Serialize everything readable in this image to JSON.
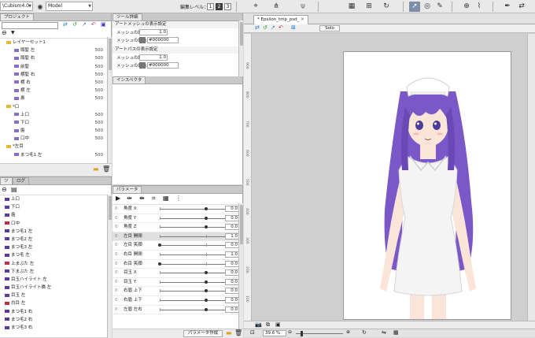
{
  "topbar": {
    "app_combo": "\\Cubism4.0",
    "mode_combo": "Model",
    "edit_level_label": "編集レベル：",
    "levels": [
      "1",
      "2",
      "3"
    ],
    "active_level": "3",
    "tool_icons": [
      "shape-icon",
      "node-icon",
      "move-icon",
      "bone-icon",
      "warp-icon",
      "rotate-icon",
      "deform-icon",
      "select-arrow-icon",
      "lasso-icon",
      "free-icon",
      "pen-icon",
      "brush-icon",
      "pin-icon",
      "mirror-icon"
    ]
  },
  "project": {
    "tab": "プロジェクト",
    "items": [
      {
        "label": "レイヤーセット1",
        "num": ""
      },
      {
        "label": "頭髪 左",
        "num": "500"
      },
      {
        "label": "頭髪 右",
        "num": "500"
      },
      {
        "label": "前髪",
        "num": "500"
      },
      {
        "label": "横髪 右",
        "num": "500"
      },
      {
        "label": "横 右",
        "num": "500"
      },
      {
        "label": "横 左",
        "num": "500"
      },
      {
        "label": "鼻",
        "num": "500"
      },
      {
        "label": "*口",
        "num": ""
      },
      {
        "label": "上口",
        "num": "500"
      },
      {
        "label": "下口",
        "num": "500"
      },
      {
        "label": "歯",
        "num": "500"
      },
      {
        "label": "口中",
        "num": "500"
      },
      {
        "label": "*左目",
        "num": ""
      },
      {
        "label": "まつ毛1 左",
        "num": "500"
      }
    ]
  },
  "tool_detail": {
    "tab": "ツール詳細",
    "section1": "アートメッシュの表示設定",
    "mesh_width_label": "メッシュの線幅",
    "mesh_width_value": "1.0",
    "mesh_color_label": "メッシュの線色",
    "mesh_color_value": "#000000",
    "section2": "アートパスの表示設定",
    "path_width_label": "メッシュの線幅",
    "path_width_value": "1.0",
    "path_color_label": "メッシュの線色",
    "path_color_value": "#000000"
  },
  "inspector": {
    "tab": "インスペクタ"
  },
  "parts": {
    "tabs": [
      "ツ",
      "ログ"
    ],
    "items": [
      "上口",
      "下口",
      "歯",
      "口中",
      "まつ毛1 左",
      "まつ毛2 左",
      "まつ毛3 左",
      "まつ毛 左",
      "上まぶた 左",
      "下まぶた 左",
      "目玉ハイライト 左",
      "目玉ハイライト橋 左",
      "目玉 左",
      "白目 左",
      "まつ毛1 右",
      "まつ毛2 右",
      "まつ毛3 右"
    ]
  },
  "parameters": {
    "tab": "パラメータ",
    "rows": [
      {
        "label": "角度 X",
        "value": "0.0",
        "pos": 0.5,
        "selected": false
      },
      {
        "label": "角度 Y",
        "value": "0.0",
        "pos": 0.5,
        "selected": false
      },
      {
        "label": "角度 Z",
        "value": "0.0",
        "pos": 0.5,
        "selected": false
      },
      {
        "label": "左目 開閉",
        "value": "1.0",
        "pos": 1.0,
        "selected": true
      },
      {
        "label": "左目 笑顔",
        "value": "0.0",
        "pos": 0.0,
        "selected": false
      },
      {
        "label": "右目 開閉",
        "value": "1.0",
        "pos": 1.0,
        "selected": false
      },
      {
        "label": "右目 笑顔",
        "value": "0.0",
        "pos": 0.0,
        "selected": false
      },
      {
        "label": "目玉 X",
        "value": "0.0",
        "pos": 0.5,
        "selected": false
      },
      {
        "label": "目玉 Y",
        "value": "0.0",
        "pos": 0.5,
        "selected": false
      },
      {
        "label": "右眉 上下",
        "value": "0.0",
        "pos": 0.5,
        "selected": false
      },
      {
        "label": "右眉 上下",
        "value": "0.0",
        "pos": 0.5,
        "selected": false
      },
      {
        "label": "左眉 左右",
        "value": "0.0",
        "pos": 0.5,
        "selected": false
      }
    ],
    "create_button": "パラメータ作成"
  },
  "canvas": {
    "tab": "* Epsilon_tmp_psd_",
    "solo": "Solo",
    "zoom": "39.6 %",
    "ruler_labels": [
      "900",
      "800",
      "700",
      "600",
      "500",
      "400",
      "300",
      "200",
      "100"
    ],
    "colors": {
      "hair": "#7b58c8",
      "dress": "#f4f4f4",
      "skin": "#fbe4d8",
      "accent": "#d04040"
    }
  }
}
